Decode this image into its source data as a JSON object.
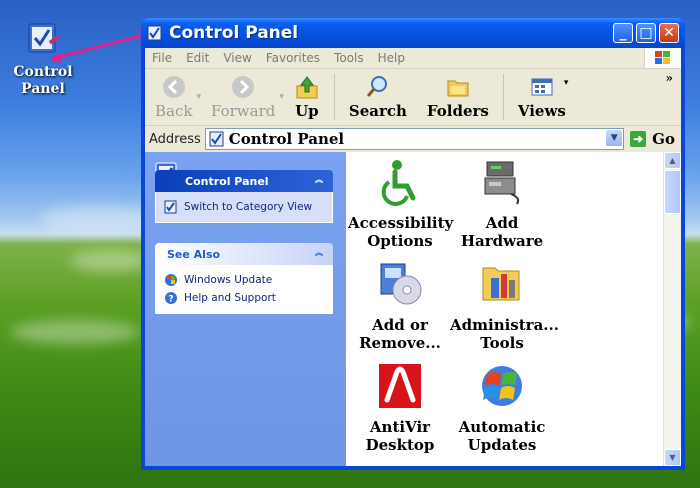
{
  "desktop": {
    "icon_label_line1": "Control",
    "icon_label_line2": "Panel"
  },
  "window": {
    "title": "Control Panel",
    "menu": [
      "File",
      "Edit",
      "View",
      "Favorites",
      "Tools",
      "Help"
    ],
    "toolbar": {
      "back": "Back",
      "forward": "Forward",
      "up": "Up",
      "search": "Search",
      "folders": "Folders",
      "views": "Views"
    },
    "address": {
      "label": "Address",
      "value": "Control Panel",
      "go": "Go"
    },
    "tasks": {
      "panel1_title": "Control Panel",
      "switch_view": "Switch to Category View",
      "panel2_title": "See Also",
      "windows_update": "Windows Update",
      "help_support": "Help and Support"
    },
    "items": [
      {
        "line1": "Accessibility",
        "line2": "Options"
      },
      {
        "line1": "Add",
        "line2": "Hardware"
      },
      {
        "line1": "Add or",
        "line2": "Remove..."
      },
      {
        "line1": "Administra...",
        "line2": "Tools"
      },
      {
        "line1": "AntiVir",
        "line2": "Desktop"
      },
      {
        "line1": "Automatic",
        "line2": "Updates"
      }
    ]
  }
}
